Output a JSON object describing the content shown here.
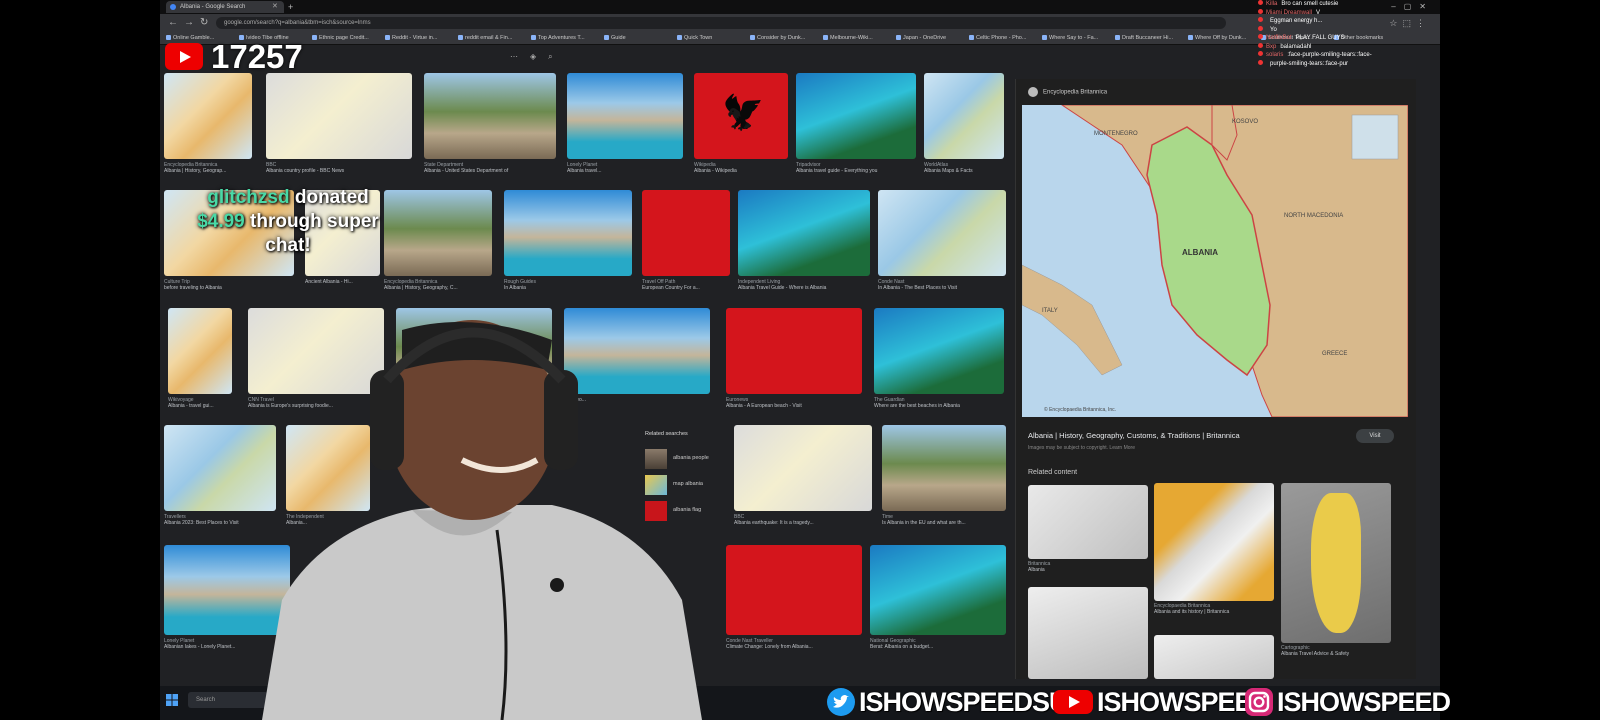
{
  "browser": {
    "tab_title": "Albania - Google Search",
    "url": "google.com/search?q=albania&tbm=isch&source=lnms",
    "bookmarks": [
      "Online Gamble...",
      "Ivideo Tibe offline",
      "Ethnic page Credit...",
      "Reddit - Virtue in...",
      "reddit email & Fin...",
      "Top Adventures T...",
      "Guide",
      "Quick Town",
      "Consider by Dunk...",
      "Melbourne-Wiki...",
      "Japan - OneDrive",
      "Celtic Phone - Pho...",
      "Where Say to - Fa...",
      "Draft Buccaneer Hi...",
      "Where Off by Dunk...",
      "Southbeat Topic...",
      "Other bookmarks"
    ]
  },
  "overlay": {
    "viewer_count": "17257",
    "donation": {
      "name": "glitchzsd",
      "word_donated": " donated",
      "amount": "$4.99",
      "rest": " through super chat!"
    }
  },
  "chat": [
    {
      "user": "Killa",
      "text": "Bro can smell cutesie"
    },
    {
      "user": "Miami Dreamwall",
      "text": "V"
    },
    {
      "user": "",
      "text": "Eggman energy h..."
    },
    {
      "user": "",
      "text": "Yo"
    },
    {
      "user": "NetflixBot",
      "text": "PLAY FALL GUYS"
    },
    {
      "user": "Bxp",
      "text": "balamadahl"
    },
    {
      "user": "solaris",
      "text": ":face-purple-smiling-tears::face-"
    },
    {
      "user": "",
      "text": "purple-smiling-tears::face-pur"
    }
  ],
  "images": {
    "row1": [
      {
        "source": "Encyclopedia Britannica",
        "title": "Albania | History, Geograp..."
      },
      {
        "source": "BBC",
        "title": "Albania country profile - BBC News"
      },
      {
        "source": "State Department",
        "title": "Albania - United States Department of"
      },
      {
        "source": "Lonely Planet",
        "title": "Albania travel..."
      },
      {
        "source": "Wikipedia",
        "title": "Albania - Wikipedia"
      },
      {
        "source": "Tripadvisor",
        "title": "Albania travel guide - Everything you"
      },
      {
        "source": "WorldAtlas",
        "title": "Albania Maps & Facts"
      }
    ],
    "row2": [
      {
        "source": "Culture Trip",
        "title": "before traveling to Albania"
      },
      {
        "source": "",
        "title": "Ancient Albania - Hi..."
      },
      {
        "source": "Encyclopedia Britannica",
        "title": "Albania | History, Geography, C..."
      },
      {
        "source": "Rough Guides",
        "title": "In Albania"
      },
      {
        "source": "Travel Off Path",
        "title": "European Country For a..."
      },
      {
        "source": "Independent Living",
        "title": "Albania Travel Guide - Where is Albania"
      },
      {
        "source": "Conde Nast",
        "title": "In Albania - The Best Places to Visit"
      }
    ],
    "row3": [
      {
        "source": "Wikivoyage",
        "title": "Albania - travel gui..."
      },
      {
        "source": "CNN Travel",
        "title": "Albania is Europe's surprising foodie..."
      },
      {
        "source": "",
        "title": ""
      },
      {
        "source": "",
        "title": "Ale Ceo..."
      },
      {
        "source": "Euronews",
        "title": "Albania - A European beach - Visit"
      },
      {
        "source": "The Guardian",
        "title": "Where are the best beaches in Albania"
      }
    ],
    "row4": [
      {
        "source": "Travellers",
        "title": "Albania 2023: Best Places to Visit"
      },
      {
        "source": "The Independent",
        "title": "Albania..."
      },
      {
        "source": "BBC",
        "title": "Albania earthquake: It is a tragedy..."
      },
      {
        "source": "Time",
        "title": "Is Albania in the EU and what are th..."
      }
    ],
    "row5": [
      {
        "source": "Lonely Planet",
        "title": "Albanian lakes - Lonely Planet..."
      },
      {
        "source": "Conde Nast Traveller",
        "title": "Climate Change: Lonely from Albania..."
      },
      {
        "source": "National Geographic",
        "title": "Berat: Albania on a budget..."
      }
    ]
  },
  "related_searches": {
    "label": "Related searches",
    "items": [
      "albania people",
      "map albania",
      "albania flag"
    ]
  },
  "panel": {
    "source": "Encyclopedia Britannica",
    "title": "Albania | History, Geography, Customs, & Traditions | Britannica",
    "subtitle": "Images may be subject to copyright. Learn More",
    "visit": "Visit",
    "related_label": "Related content",
    "map_labels": {
      "montenegro": "MONTENEGRO",
      "kosovo": "KOSOVO",
      "albania": "ALBANIA",
      "north_macedonia": "NORTH MACEDONIA",
      "italy": "ITALY",
      "greece": "GREECE",
      "credit": "© Encyclopaedia Britannica, Inc."
    },
    "related": [
      {
        "source": "Britannica",
        "title": "Albania"
      },
      {
        "source": "Encyclopaedia Britannica",
        "title": "Albania and its history | Britannica"
      },
      {
        "source": "Cartographic",
        "title": "Albania Travel Advice & Safety"
      }
    ]
  },
  "taskbar": {
    "search": "Search"
  },
  "socials": {
    "twitter": "ISHOWSPEEDSUI",
    "youtube": "ISHOWSPEED",
    "instagram": "ISHOWSPEED"
  }
}
